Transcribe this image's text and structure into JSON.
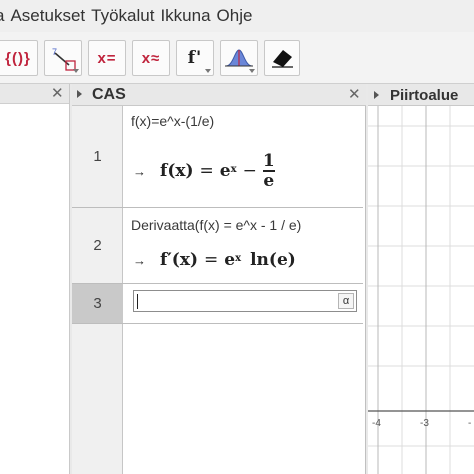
{
  "menu": {
    "items": [
      "a",
      "Asetukset",
      "Työkalut",
      "Ikkuna",
      "Ohje"
    ]
  },
  "toolbar": {
    "tools": [
      {
        "name": "list-tool",
        "label": "{()}"
      },
      {
        "name": "slope-tool",
        "label": ""
      },
      {
        "name": "evaluate-tool",
        "label": "x="
      },
      {
        "name": "numeric-tool",
        "label": "x≈"
      },
      {
        "name": "derivative-tool",
        "label": "f'"
      },
      {
        "name": "probability-tool",
        "label": ""
      },
      {
        "name": "delete-tool",
        "label": ""
      }
    ]
  },
  "cas": {
    "title": "CAS",
    "rows": [
      {
        "number": "1",
        "input": "f(x)=e^x-(1/e)",
        "output": {
          "lhs": "f(x)",
          "eq": "=",
          "base": "e",
          "exp": "x",
          "minus": "−",
          "num": "1",
          "den": "e"
        }
      },
      {
        "number": "2",
        "input": "Derivaatta(f(x) = e^x - 1 / e)",
        "output": {
          "lhs": "f′(x)",
          "eq": "=",
          "base": "e",
          "exp": "x",
          "tail": "ln(e)"
        }
      },
      {
        "number": "3",
        "input": "",
        "alpha_button": "α"
      }
    ]
  },
  "graphics": {
    "title": "Piirtoalue",
    "x_ticks": [
      "-4",
      "-3",
      "-"
    ]
  },
  "colors": {
    "accent": "#c0243d",
    "grid": "#d9d9d9",
    "axis": "#555555"
  }
}
